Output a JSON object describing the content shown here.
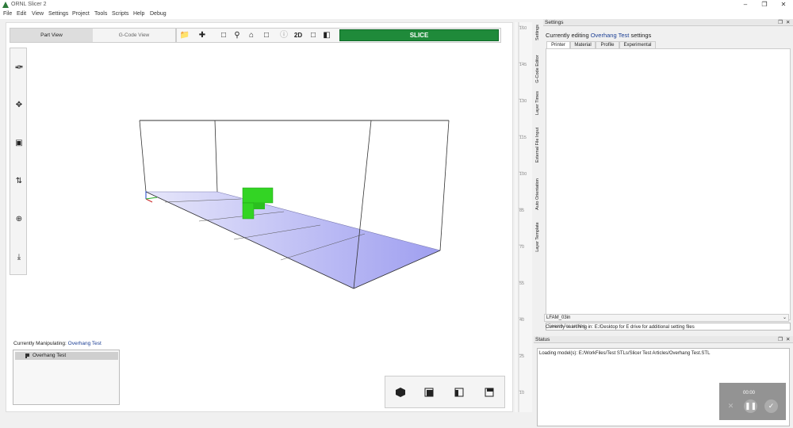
{
  "app": {
    "title": "ORNL Slicer 2"
  },
  "menu": [
    "File",
    "Edit",
    "View",
    "Settings",
    "Project",
    "Tools",
    "Scripts",
    "Help",
    "Debug"
  ],
  "view_tabs": {
    "part": "Part View",
    "gcode": "G-Code View"
  },
  "toolbar": {
    "two_d": "2D",
    "slice": "SLICE"
  },
  "manipulating": {
    "label": "Currently Manipulating:",
    "name": "Overhang Test"
  },
  "objects": [
    "Overhang Test"
  ],
  "ruler_labels": [
    "160",
    "145",
    "130",
    "115",
    "100",
    "85",
    "70",
    "55",
    "40",
    "25",
    "10"
  ],
  "side_tabs": [
    "Settings",
    "G-Code Editor",
    "Layer Times",
    "External File Input",
    "Auto Orientation",
    "Layer Template"
  ],
  "settings": {
    "title": "Settings",
    "editing_prefix": "Currently editing",
    "editing_name": "Overhang Test",
    "editing_suffix": "settings",
    "tabs": [
      "Printer",
      "Material",
      "Profile",
      "Experimental"
    ],
    "search_placeholder": "Search for setting...",
    "template": "LFAM_03in",
    "searching": "Currently searching in: E:/Desktop for E drive for additional setting files"
  },
  "status": {
    "title": "Status",
    "message": "Loading model(s): E:/WorkFiles/Test STLs/Slicer Test Articles/Overhang Test.STL"
  },
  "recording": {
    "time": "00:00"
  },
  "colors": {
    "slice": "#1f8a3a",
    "model": "#33d424",
    "bed": "#b3b3f5",
    "accent": "#1c3f94"
  }
}
